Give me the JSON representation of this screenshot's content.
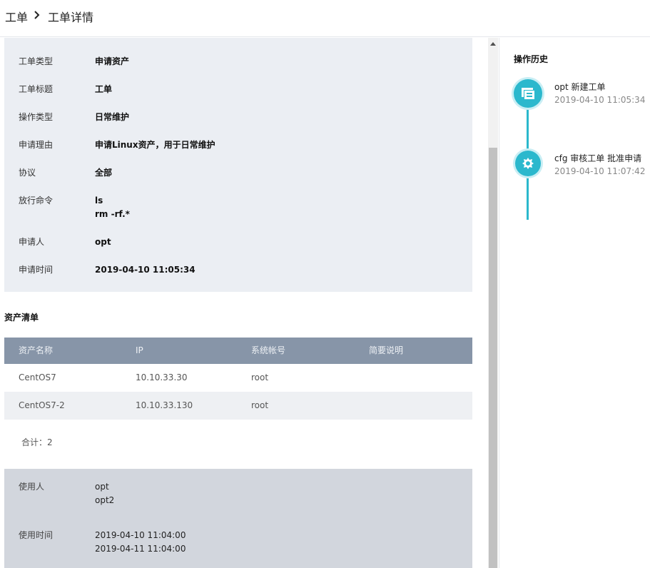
{
  "breadcrumb": {
    "root": "工单",
    "current": "工单详情"
  },
  "info": [
    {
      "label": "工单类型",
      "values": [
        "申请资产"
      ]
    },
    {
      "label": "工单标题",
      "values": [
        "工单"
      ]
    },
    {
      "label": "操作类型",
      "values": [
        "日常维护"
      ]
    },
    {
      "label": "申请理由",
      "values": [
        "申请Linux资产，用于日常维护"
      ]
    },
    {
      "label": "协议",
      "values": [
        "全部"
      ]
    },
    {
      "label": "放行命令",
      "values": [
        "ls",
        "rm -rf.*"
      ]
    },
    {
      "label": "申请人",
      "values": [
        "opt"
      ]
    },
    {
      "label": "申请时间",
      "values": [
        "2019-04-10 11:05:34"
      ]
    }
  ],
  "assets": {
    "title": "资产清单",
    "columns": [
      "资产名称",
      "IP",
      "系统帐号",
      "简要说明"
    ],
    "rows": [
      [
        "CentOS7",
        "10.10.33.30",
        "root",
        ""
      ],
      [
        "CentOS7-2",
        "10.10.33.130",
        "root",
        ""
      ]
    ],
    "total": "合计：2"
  },
  "usage": [
    {
      "label": "使用人",
      "values": [
        "opt",
        "opt2"
      ]
    },
    {
      "label": "使用时间",
      "values": [
        "2019-04-10 11:04:00",
        "2019-04-11 11:04:00"
      ]
    }
  ],
  "history": {
    "title": "操作历史",
    "items": [
      {
        "icon": "ticket-icon",
        "text": "opt 新建工单",
        "time": "2019-04-10 11:05:34"
      },
      {
        "icon": "gear-icon",
        "text": "cfg 审核工单 批准申请",
        "time": "2019-04-10 11:07:42"
      }
    ]
  },
  "colors": {
    "accent": "#2bb8cd",
    "table_header": "#8795a8",
    "info_bg": "#ebeef3",
    "usage_bg": "#d2d6dd"
  }
}
